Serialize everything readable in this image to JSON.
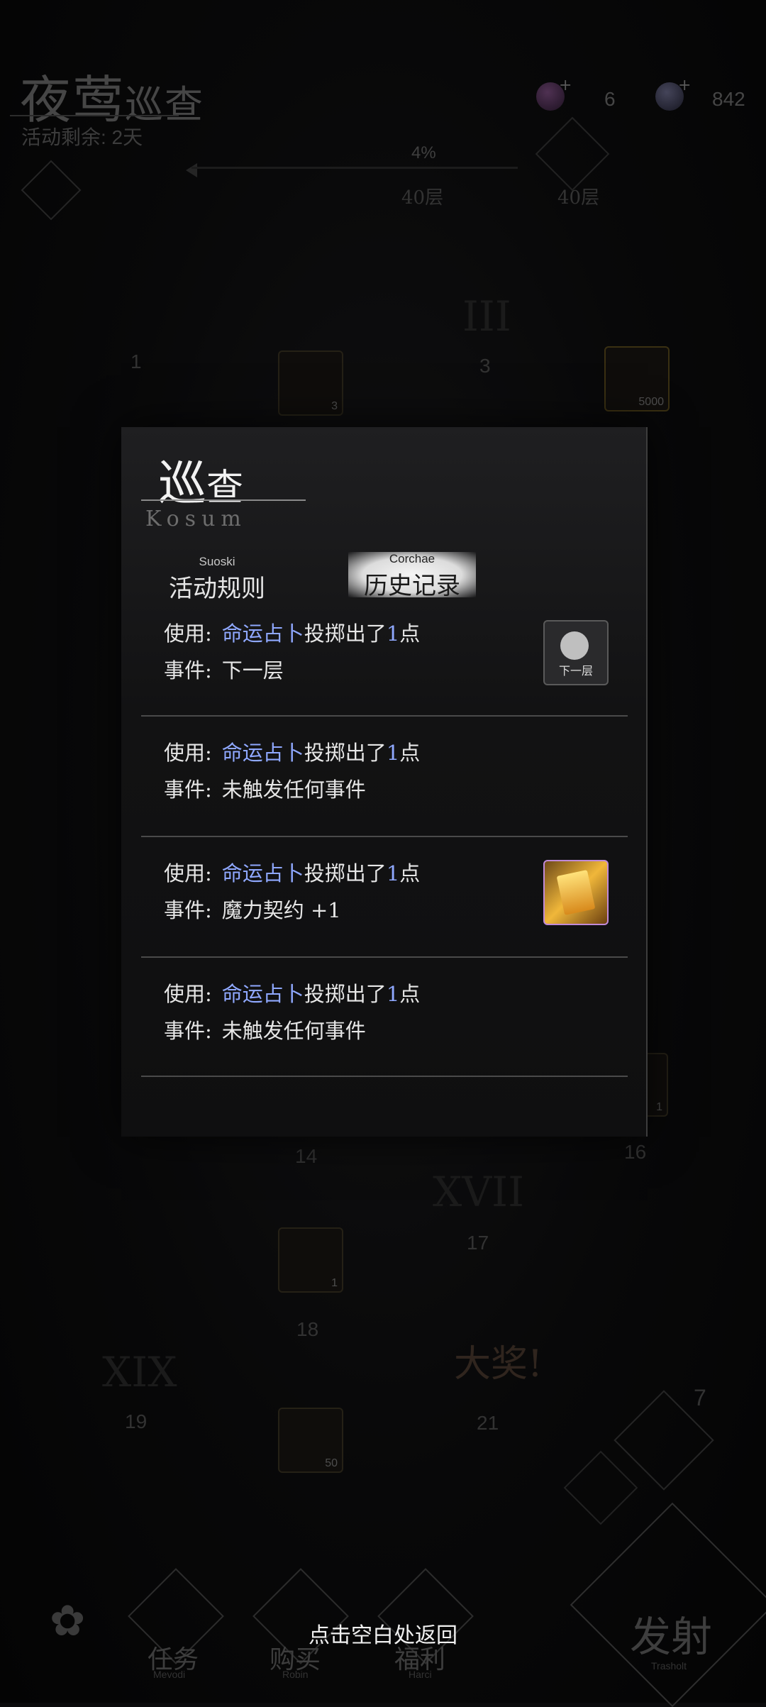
{
  "header": {
    "title_main": "夜莺",
    "title_sub": "巡查",
    "remaining": "活动剩余: 2天",
    "currency_1": "6",
    "currency_2": "842",
    "progress_pct": "4%",
    "floor_left": "40层",
    "floor_right": "40层"
  },
  "board": {
    "node_1": "1",
    "node_3": "3",
    "roman_3": "III",
    "tile_beetle_count": "3",
    "tile_gem_count": "5000",
    "node_14": "14",
    "node_16": "16",
    "roman_17": "XVII",
    "node_17": "17",
    "tile_dice_count": "1",
    "node_18": "18",
    "roman_19": "XIX",
    "node_19": "19",
    "node_21": "21",
    "jackpot": "大奖!",
    "tile_crystal_count": "50",
    "side_tile_count": "1",
    "dice_count": "7"
  },
  "dialog": {
    "title_main": "巡",
    "title_rest": "查",
    "subtitle": "Kosum",
    "tabs": [
      {
        "en": "Suoski",
        "zh": "活动规则"
      },
      {
        "en": "Corchae",
        "zh": "历史记录"
      }
    ],
    "records": [
      {
        "use_label": "使用:",
        "item": "命运占卜",
        "action": "投掷出了",
        "points": "1",
        "unit": "点",
        "event_label": "事件:",
        "event": "下一层",
        "icon": "next-floor-icon",
        "icon_text": "下一层"
      },
      {
        "use_label": "使用:",
        "item": "命运占卜",
        "action": "投掷出了",
        "points": "1",
        "unit": "点",
        "event_label": "事件:",
        "event": "未触发任何事件"
      },
      {
        "use_label": "使用:",
        "item": "命运占卜",
        "action": "投掷出了",
        "points": "1",
        "unit": "点",
        "event_label": "事件:",
        "event": "魔力契约 +1",
        "icon": "magic-contract-icon"
      },
      {
        "use_label": "使用:",
        "item": "命运占卜",
        "action": "投掷出了",
        "points": "1",
        "unit": "点",
        "event_label": "事件:",
        "event": "未触发任何事件"
      }
    ]
  },
  "bottom": {
    "hint": "点击空白处返回",
    "nav": [
      {
        "zh": "任务",
        "en": "Mevodi"
      },
      {
        "zh": "购买",
        "en": "Robin"
      },
      {
        "zh": "福利",
        "en": "Harci"
      }
    ],
    "fire": "发射",
    "fire_en": "Trasholt"
  },
  "colors": {
    "accent_link": "#8fa8ff",
    "contract_border": "#c08ad8"
  }
}
